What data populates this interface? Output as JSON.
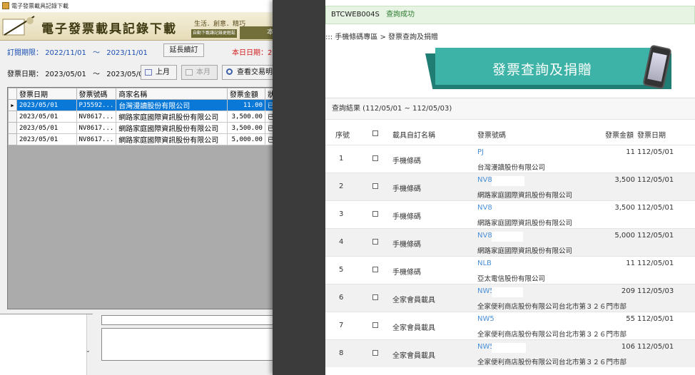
{
  "left_window": {
    "title": "電子發票載具記錄下載",
    "banner": {
      "title": "電子發票載具記錄下載",
      "subtitle": "生活．創意．精巧",
      "sub_small": "自動下載謙記錄更輕鬆",
      "tab_label": "本"
    },
    "subscription": {
      "label": "訂閱期限：",
      "start": "2022/11/01",
      "sep": "～",
      "end": "2023/11/01"
    },
    "extend_button": "延長續訂",
    "today_label": "本日日期：20",
    "invoice_date": {
      "label": "發票日期：",
      "start": "2023/05/01",
      "sep": "～",
      "end": "2023/05/03"
    },
    "buttons": {
      "prev_month": "上月",
      "this_month": "本月",
      "view_detail": "查看交易明"
    },
    "grid": {
      "columns": [
        "發票日期",
        "發票號碼",
        "商家名稱",
        "發票金額",
        "狀"
      ],
      "rows": [
        {
          "date": "2023/05/01",
          "number": "PJ5592...",
          "seller": "台灣漫讀股份有限公司",
          "amount": "11.00",
          "status": "已"
        },
        {
          "date": "2023/05/01",
          "number": "NV8617...",
          "seller": "網路家庭國際資訊股份有限公司",
          "amount": "3,500.00",
          "status": "已"
        },
        {
          "date": "2023/05/01",
          "number": "NV8617...",
          "seller": "網路家庭國際資訊股份有限公司",
          "amount": "3,500.00",
          "status": "已"
        },
        {
          "date": "2023/05/01",
          "number": "NV8617...",
          "seller": "網路家庭國際資訊股份有限公司",
          "amount": "5,000.00",
          "status": "已"
        }
      ]
    },
    "tiny_label": "00",
    "colors": {
      "accent": "#0a78d7",
      "red": "#d31c1c",
      "blue": "#1a4fb4"
    }
  },
  "right_window": {
    "alert": {
      "code": "BTCWEB004S",
      "message": "查詢成功"
    },
    "breadcrumb": "::: 手機條碼專區 > 發票查詢及捐贈",
    "hero_title": "發票查詢及捐贈",
    "results_header": "查詢結果 (112/05/01 ~ 112/05/03)",
    "columns": {
      "seq": "序號",
      "carrier": "載具自訂名稱",
      "invoice_no": "發票號碼",
      "amount": "發票金額",
      "date": "發票日期"
    },
    "rows": [
      {
        "seq": "1",
        "carrier": "手機條碼",
        "inv": "PJ",
        "seller": "台灣漫讀股份有限公司",
        "amount": "11",
        "date": "112/05/01"
      },
      {
        "seq": "2",
        "carrier": "手機條碼",
        "inv": "NV8",
        "seller": "網路家庭國際資訊股份有限公司",
        "amount": "3,500",
        "date": "112/05/01"
      },
      {
        "seq": "3",
        "carrier": "手機條碼",
        "inv": "NV8",
        "seller": "網路家庭國際資訊股份有限公司",
        "amount": "3,500",
        "date": "112/05/01"
      },
      {
        "seq": "4",
        "carrier": "手機條碼",
        "inv": "NV8",
        "seller": "網路家庭國際資訊股份有限公司",
        "amount": "5,000",
        "date": "112/05/01"
      },
      {
        "seq": "5",
        "carrier": "手機條碼",
        "inv": "NLB",
        "seller": "亞太電信股份有限公司",
        "amount": "11",
        "date": "112/05/01"
      },
      {
        "seq": "6",
        "carrier": "全家會員載具",
        "inv": "NW5",
        "seller": "全家便利商店股份有限公司台北市第３２６門市部",
        "amount": "209",
        "date": "112/05/03"
      },
      {
        "seq": "7",
        "carrier": "全家會員載具",
        "inv": "NW5",
        "seller": "全家便利商店股份有限公司台北市第３２６門市部",
        "amount": "55",
        "date": "112/05/01"
      },
      {
        "seq": "8",
        "carrier": "全家會員載具",
        "inv": "NW5",
        "seller": "全家便利商店股份有限公司台北市第３２６門市部",
        "amount": "106",
        "date": "112/05/01"
      }
    ],
    "colors": {
      "teal": "#3cb3a6",
      "teal_dark": "#1f7d74",
      "link": "#4a90d9",
      "success_bg": "#e7f3e3"
    }
  }
}
